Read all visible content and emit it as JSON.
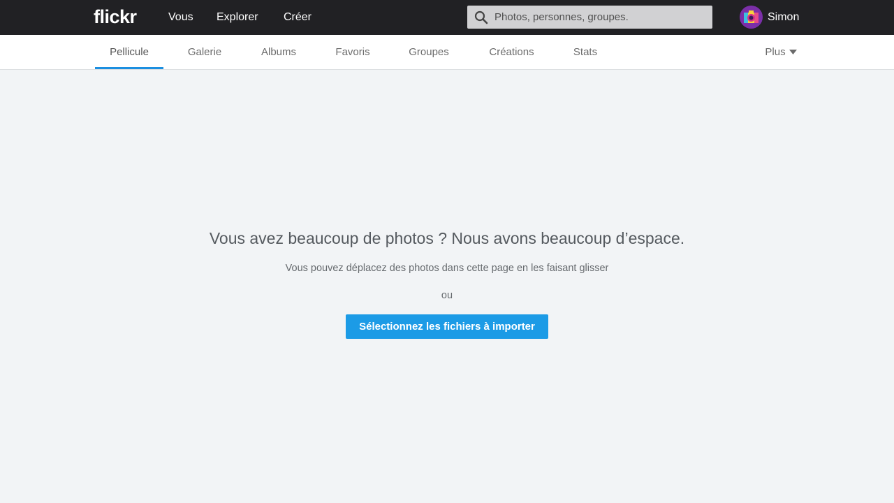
{
  "header": {
    "logo": "flickr",
    "nav": [
      "Vous",
      "Explorer",
      "Créer"
    ],
    "search_placeholder": "Photos, personnes, groupes.",
    "user_name": "Simon"
  },
  "subnav": {
    "items": [
      "Pellicule",
      "Galerie",
      "Albums",
      "Favoris",
      "Groupes",
      "Créations",
      "Stats"
    ],
    "active": "Pellicule",
    "more_label": "Plus"
  },
  "empty_state": {
    "headline": "Vous avez beaucoup de photos ? Nous avons beaucoup d’espace.",
    "subtext": "Vous pouvez déplacez des photos dans cette page en les faisant glisser",
    "or": "ou",
    "button_label": "Sélectionnez les fichiers à importer"
  },
  "colors": {
    "topbar": "#212124",
    "accent": "#1c9be6",
    "active_tab_underline": "#1c8fe0",
    "background": "#f2f4f6"
  }
}
